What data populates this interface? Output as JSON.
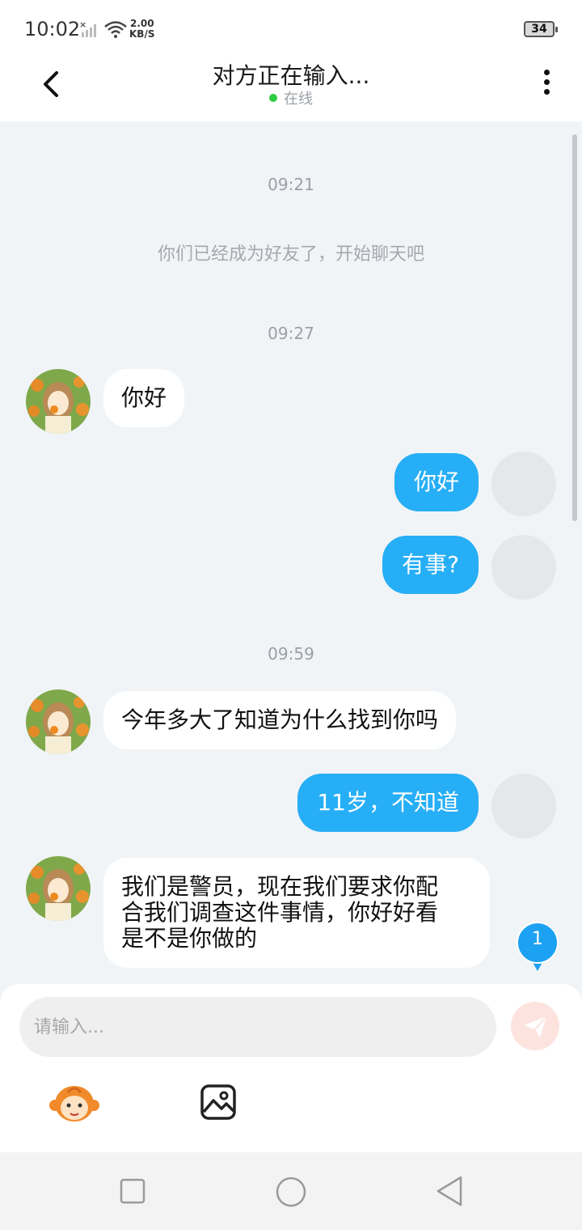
{
  "status_bar": {
    "time": "10:02",
    "speed_value": "2.00",
    "speed_unit": "KB/S",
    "battery": "34"
  },
  "header": {
    "title": "对方正在输入...",
    "status": "在线"
  },
  "chat": {
    "timestamp_1": "09:21",
    "system_message": "你们已经成为好友了，开始聊天吧",
    "timestamp_2": "09:27",
    "msg_1": "你好",
    "msg_2": "你好",
    "msg_3": "有事?",
    "timestamp_3": "09:59",
    "msg_4": "今年多大了知道为什么找到你吗",
    "msg_5": "11岁，不知道",
    "msg_6_line1": "我们是警员，现在我们要求你配",
    "msg_6_line2": "合我们调查这件事情，你好好看",
    "msg_6_line3": "是不是你做的",
    "unread_count": "1"
  },
  "input": {
    "placeholder": "请输入..."
  },
  "colors": {
    "outgoing_bubble": "#26aef6",
    "incoming_bubble": "#ffffff",
    "online_dot": "#2ecc40",
    "chat_background": "#f1f4f7"
  },
  "icons": {
    "back": "chevron-left-icon",
    "more": "more-vertical-icon",
    "send": "paper-plane-icon",
    "emoji": "monkey-emoji-icon",
    "image": "image-icon"
  }
}
